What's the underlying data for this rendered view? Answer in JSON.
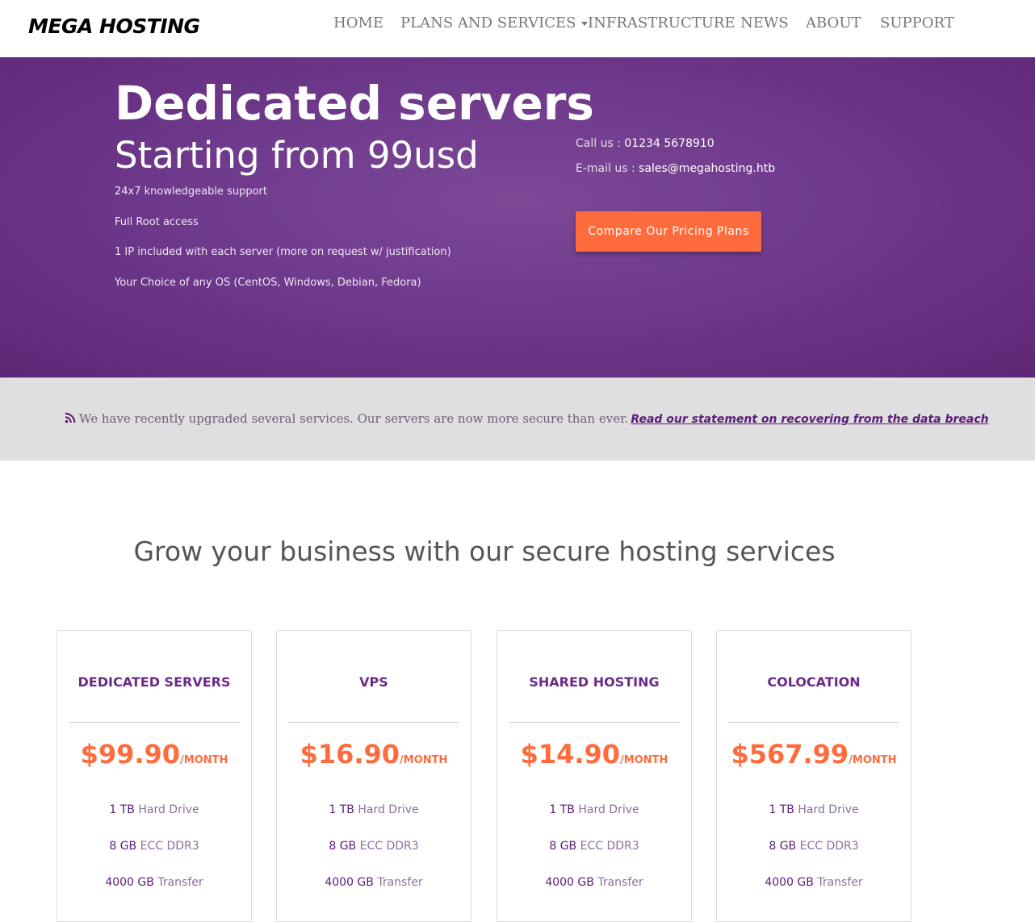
{
  "brand": {
    "logo_text": "MEGA HOSTING"
  },
  "nav": {
    "items": [
      {
        "label": "HOME"
      },
      {
        "label": "PLANS AND SERVICES",
        "has_dropdown": true
      },
      {
        "label": "INFRASTRUCTURE"
      },
      {
        "label": "NEWS"
      },
      {
        "label": "ABOUT"
      },
      {
        "label": "SUPPORT"
      }
    ]
  },
  "hero": {
    "title": "Dedicated servers",
    "subtitle": "Starting from 99usd",
    "features": [
      "24x7 knowledgeable support",
      "Full Root access",
      "1 IP included with each server (more on request w/ justification)",
      "Your Choice of any OS (CentOS, Windows, Debian, Fedora)"
    ],
    "call_label": "Call us :",
    "call_value": "01234 5678910",
    "email_label": "E-mail us :",
    "email_value": "sales@megahosting.htb",
    "cta_label": "Compare Our Pricing Plans"
  },
  "announcement": {
    "icon": "rss-icon",
    "text": "We have recently upgraded several services. Our servers are now more secure than ever.",
    "link_text": "Read our statement on recovering from the data breach"
  },
  "section": {
    "title": "Grow your business with our secure hosting services"
  },
  "plans": [
    {
      "name": "DEDICATED SERVERS",
      "price": "$99.90",
      "period": "/MONTH",
      "specs": [
        {
          "value": "1 TB",
          "label": "Hard Drive"
        },
        {
          "value": "8 GB",
          "label": "ECC DDR3"
        },
        {
          "value": "4000 GB",
          "label": "Transfer"
        }
      ]
    },
    {
      "name": "VPS",
      "price": "$16.90",
      "period": "/MONTH",
      "specs": [
        {
          "value": "1 TB",
          "label": "Hard Drive"
        },
        {
          "value": "8 GB",
          "label": "ECC DDR3"
        },
        {
          "value": "4000 GB",
          "label": "Transfer"
        }
      ]
    },
    {
      "name": "SHARED HOSTING",
      "price": "$14.90",
      "period": "/MONTH",
      "specs": [
        {
          "value": "1 TB",
          "label": "Hard Drive"
        },
        {
          "value": "8 GB",
          "label": "ECC DDR3"
        },
        {
          "value": "4000 GB",
          "label": "Transfer"
        }
      ]
    },
    {
      "name": "COLOCATION",
      "price": "$567.99",
      "period": "/MONTH",
      "specs": [
        {
          "value": "1 TB",
          "label": "Hard Drive"
        },
        {
          "value": "8 GB",
          "label": "ECC DDR3"
        },
        {
          "value": "4000 GB",
          "label": "Transfer"
        }
      ]
    }
  ],
  "colors": {
    "brand_purple": "#6f3a8c",
    "accent_orange": "#ff6b3c",
    "link_purple": "#5b1b7a"
  }
}
